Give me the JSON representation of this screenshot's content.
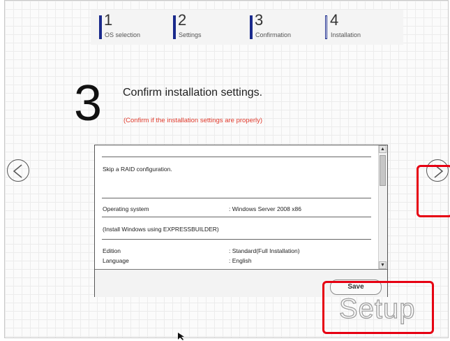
{
  "steps": [
    {
      "number": "1",
      "label": "OS selection"
    },
    {
      "number": "2",
      "label": "Settings"
    },
    {
      "number": "3",
      "label": "Confirmation"
    },
    {
      "number": "4",
      "label": "Installation"
    }
  ],
  "current_step_index": 3,
  "page": {
    "step_number": "3",
    "title": "Confirm installation settings.",
    "subtitle": "(Confirm if the installation settings are properly)"
  },
  "settings": {
    "raid_text": "Skip a RAID configuration.",
    "os_label": "Operating system",
    "os_value": ": Windows Server 2008 x86",
    "install_note": "(Install Windows using EXPRESSBUILDER)",
    "edition_label": "Edition",
    "edition_value": ": Standard(Full Installation)",
    "language_label": "Language",
    "language_value": ": English"
  },
  "buttons": {
    "save_label": "Save"
  },
  "brand": {
    "logo_text": "Setup"
  },
  "colors": {
    "accent_navy": "#1a2a8c",
    "subtitle_red": "#e03a2c",
    "highlight_red": "#e60012"
  },
  "icons": [
    "back-arrow-icon",
    "forward-arrow-icon",
    "scroll-up-icon",
    "scroll-down-icon",
    "mouse-cursor-icon"
  ]
}
